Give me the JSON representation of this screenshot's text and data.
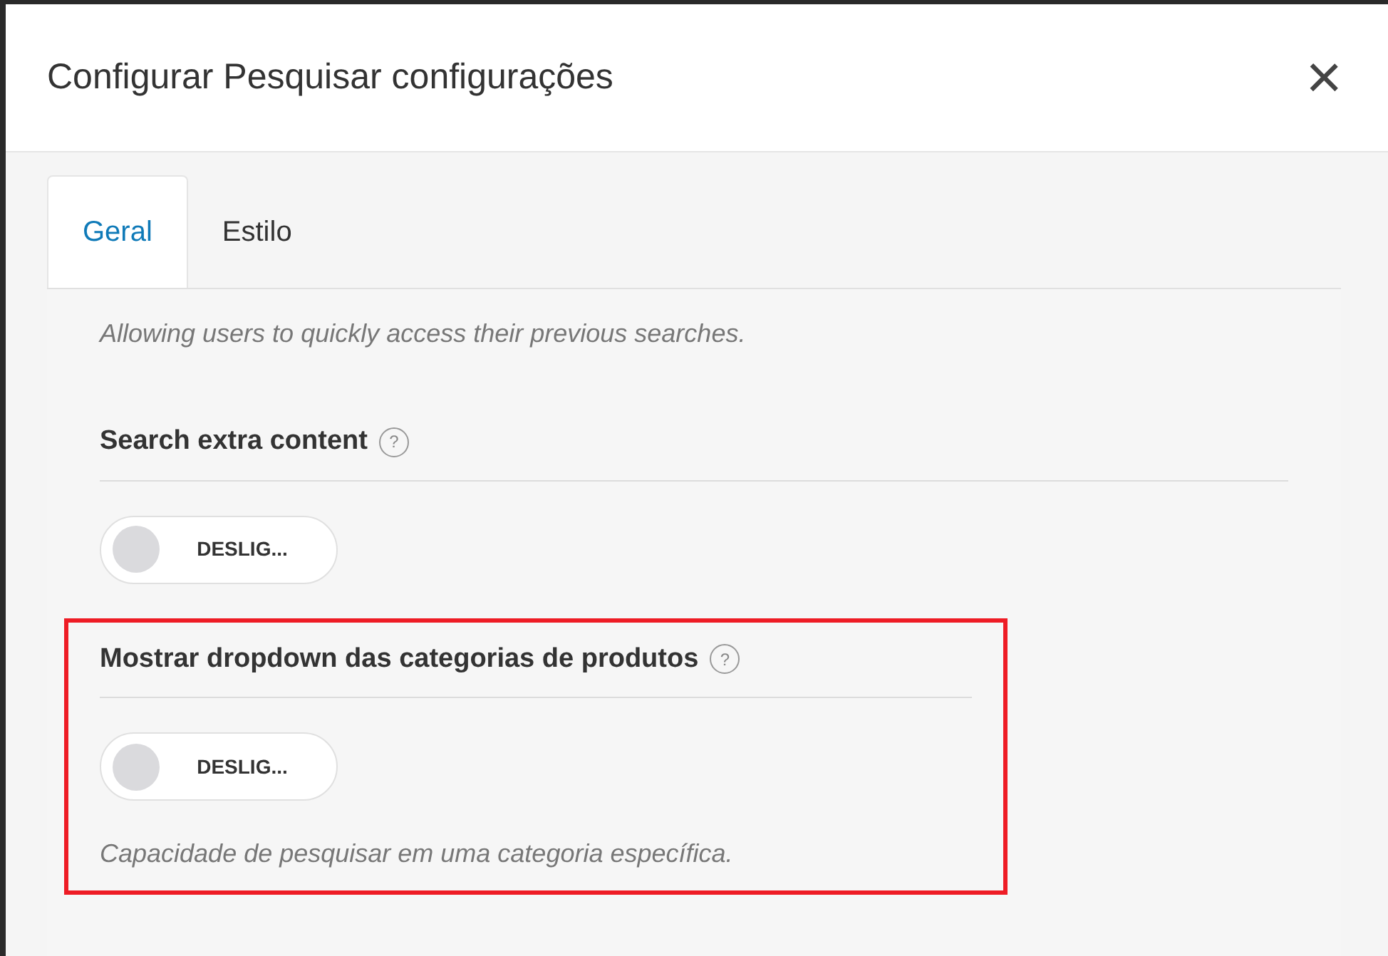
{
  "dialog": {
    "title": "Configurar Pesquisar configurações",
    "close_glyph": "×"
  },
  "tabs": [
    {
      "label": "Geral",
      "selected": true
    },
    {
      "label": "Estilo",
      "selected": false
    }
  ],
  "settings": [
    {
      "kind": "note",
      "description": "Allowing users to quickly access their previous searches.",
      "highlighted": false
    },
    {
      "kind": "toggle",
      "label": "Search extra content",
      "help": "?",
      "on": false,
      "state_text": "DESLIG...",
      "highlighted": false
    },
    {
      "kind": "toggle",
      "label": "Mostrar dropdown das categorias de produtos",
      "help": "?",
      "on": false,
      "state_text": "DESLIG...",
      "description": "Capacidade de pesquisar em uma categoria específica.",
      "highlighted": true
    }
  ]
}
